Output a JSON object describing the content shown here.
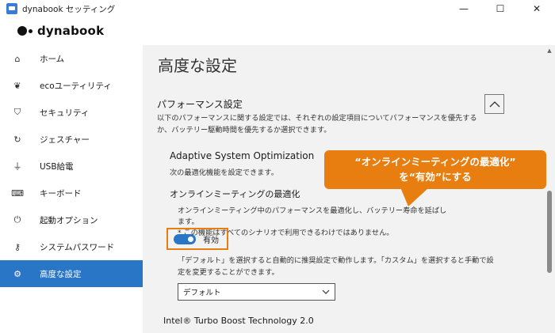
{
  "window": {
    "title": "dynabook セッティング",
    "controls": {
      "minimize": "—",
      "maximize": "☐",
      "close": "✕"
    }
  },
  "brand": {
    "name": "dynabook"
  },
  "sidebar": {
    "items": [
      {
        "label": "ホーム",
        "icon": "home-icon",
        "glyph": "⌂"
      },
      {
        "label": "ecoユーティリティ",
        "icon": "eco-icon",
        "glyph": "❦"
      },
      {
        "label": "セキュリティ",
        "icon": "shield-icon",
        "glyph": "⛉"
      },
      {
        "label": "ジェスチャー",
        "icon": "gesture-icon",
        "glyph": "↻"
      },
      {
        "label": "USB給電",
        "icon": "usb-icon",
        "glyph": "⏚"
      },
      {
        "label": "キーボード",
        "icon": "keyboard-icon",
        "glyph": "⌨"
      },
      {
        "label": "起動オプション",
        "icon": "power-icon",
        "glyph": "⏻"
      },
      {
        "label": "システムパスワード",
        "icon": "key-icon",
        "glyph": "⚷"
      },
      {
        "label": "高度な設定",
        "icon": "gear-icon",
        "glyph": "⚙",
        "active": true
      }
    ]
  },
  "main": {
    "title": "高度な設定",
    "section": {
      "title": "パフォーマンス設定",
      "description": "以下のパフォーマンスに関する設定では、それぞれの設定項目についてパフォーマンスを優先するか、バッテリー駆動時間を優先するか選択できます。"
    },
    "aso": {
      "title": "Adaptive System Optimization",
      "description": "次の最適化機能を設定できます。"
    },
    "online_meeting": {
      "title": "オンラインミーティングの最適化",
      "description_line1": "オンラインミーティング中のパフォーマンスを最適化し、バッテリー寿命を延ばします。",
      "description_line2": "* この機能はすべてのシナリオで利用できるわけではありません。",
      "toggle_label": "有効",
      "toggle_on": true
    },
    "default_desc": "「デフォルト」を選択すると自動的に推奨設定で動作します。「カスタム」を選択すると手動で設定を変更することができます。",
    "mode_select": {
      "value": "デフォルト"
    },
    "turbo": {
      "title": "Intel® Turbo Boost Technology 2.0"
    }
  },
  "callout": {
    "line1": "“オンラインミーティングの最適化”",
    "line2": "を“有効”にする"
  },
  "colors": {
    "accent": "#2a76c6",
    "callout": "#e87d10",
    "main_bg": "#f2f2f2"
  }
}
